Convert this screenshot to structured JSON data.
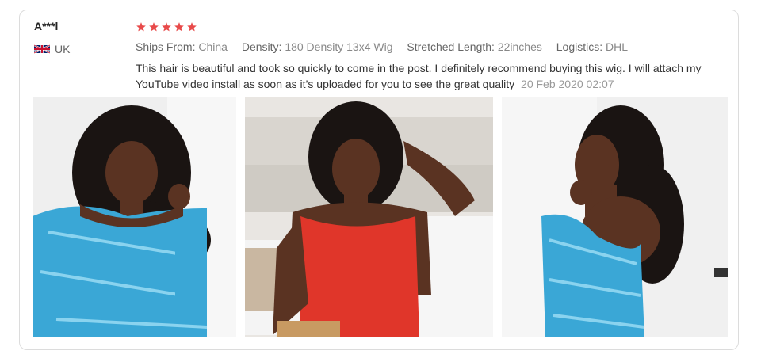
{
  "review": {
    "reviewer_name": "A***l",
    "country": "UK",
    "rating": 5,
    "meta": {
      "ships_from_label": "Ships From:",
      "ships_from_value": "China",
      "density_label": "Density:",
      "density_value": "180 Density 13x4 Wig",
      "length_label": "Stretched Length:",
      "length_value": "22inches",
      "logistics_label": "Logistics:",
      "logistics_value": "DHL"
    },
    "text": "This hair is beautiful and took so quickly to come in the post. I definitely recommend buying this wig. I will attach my YouTube video install as soon as it’s uploaded for you to see the great quality",
    "date": "20 Feb 2020 02:07"
  },
  "colors": {
    "star": "#e84a4a",
    "blue_dress": "#3aa7d6",
    "red_dress": "#e0362a",
    "skin": "#5a3322",
    "hair": "#1a1412"
  },
  "icons": [
    "uk-flag-icon",
    "star-icon"
  ]
}
